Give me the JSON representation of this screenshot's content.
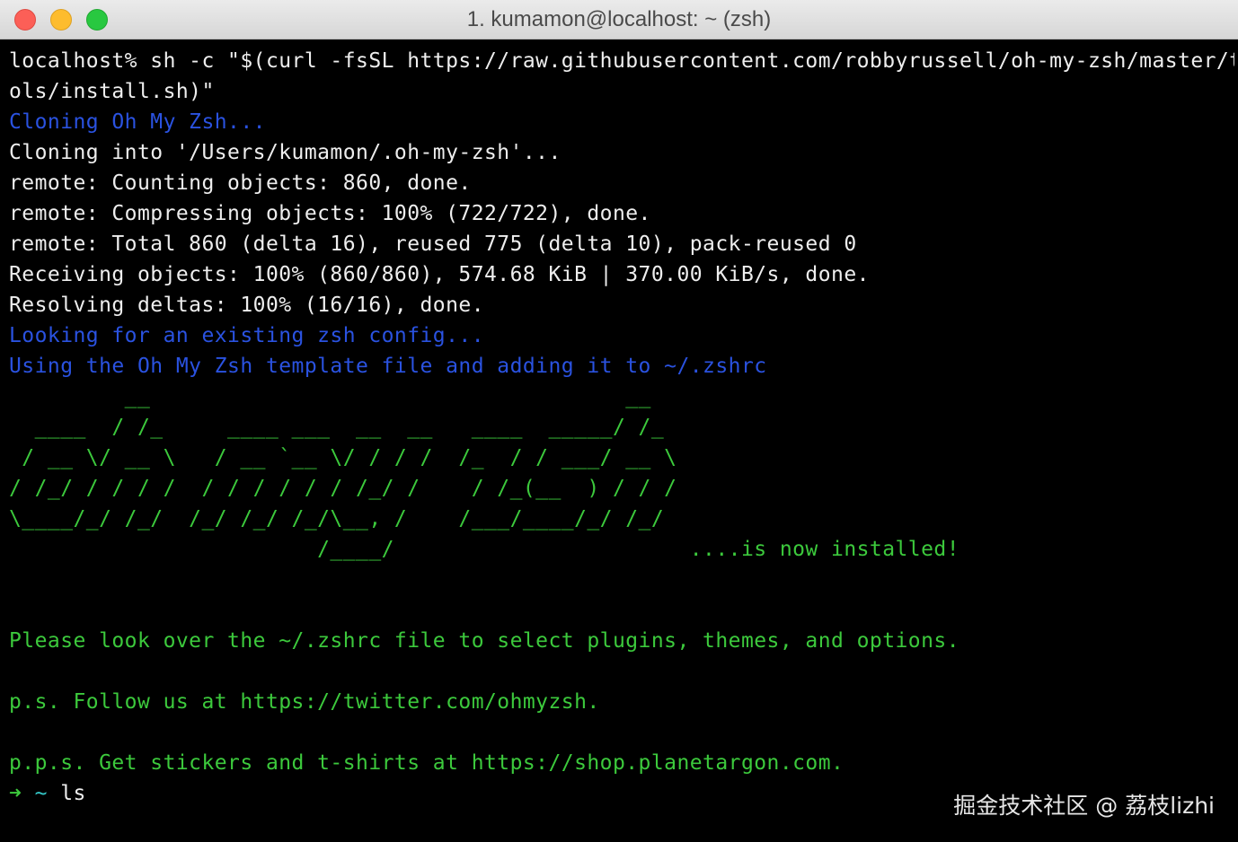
{
  "window": {
    "title": "1. kumamon@localhost: ~ (zsh)"
  },
  "terminal": {
    "lines": [
      {
        "text": "localhost% sh -c \"$(curl -fsSL https://raw.githubusercontent.com/robbyrussell/oh-my-zsh/master/to",
        "color": "default"
      },
      {
        "text": "ols/install.sh)\"",
        "color": "default"
      },
      {
        "text": "Cloning Oh My Zsh...",
        "color": "blue"
      },
      {
        "text": "Cloning into '/Users/kumamon/.oh-my-zsh'...",
        "color": "default"
      },
      {
        "text": "remote: Counting objects: 860, done.",
        "color": "default"
      },
      {
        "text": "remote: Compressing objects: 100% (722/722), done.",
        "color": "default"
      },
      {
        "text": "remote: Total 860 (delta 16), reused 775 (delta 10), pack-reused 0",
        "color": "default"
      },
      {
        "text": "Receiving objects: 100% (860/860), 574.68 KiB | 370.00 KiB/s, done.",
        "color": "default"
      },
      {
        "text": "Resolving deltas: 100% (16/16), done.",
        "color": "default"
      },
      {
        "text": "Looking for an existing zsh config...",
        "color": "blue"
      },
      {
        "text": "Using the Oh My Zsh template file and adding it to ~/.zshrc",
        "color": "blue"
      },
      {
        "text": "         __                                     __",
        "color": "green"
      },
      {
        "text": "  ____  / /_     ____ ___  __  __   ____  _____/ /_",
        "color": "green"
      },
      {
        "text": " / __ \\/ __ \\   / __ `__ \\/ / / /  /_  / / ___/ __ \\",
        "color": "green"
      },
      {
        "text": "/ /_/ / / / /  / / / / / / /_/ /    / /_(__  ) / / /",
        "color": "green"
      },
      {
        "text": "\\____/_/ /_/  /_/ /_/ /_/\\__, /    /___/____/_/ /_/",
        "color": "green"
      },
      {
        "text": "                        /____/                       ....is now installed!",
        "color": "green"
      },
      {
        "text": "",
        "color": "default"
      },
      {
        "text": "",
        "color": "default"
      },
      {
        "text": "Please look over the ~/.zshrc file to select plugins, themes, and options.",
        "color": "green"
      },
      {
        "text": "",
        "color": "default"
      },
      {
        "text": "p.s. Follow us at https://twitter.com/ohmyzsh.",
        "color": "green"
      },
      {
        "text": "",
        "color": "default"
      },
      {
        "text": "p.p.s. Get stickers and t-shirts at https://shop.planetargon.com.",
        "color": "green"
      }
    ],
    "prompt": {
      "arrow": "➜",
      "cwd": "~",
      "command": "ls"
    }
  },
  "watermark": "掘金技术社区 @ 荔枝lizhi",
  "colors": {
    "background": "#000000",
    "default_text": "#eeeeee",
    "blue_text": "#2a52e0",
    "green_text": "#3cc93c",
    "close_button": "#fc5f57",
    "minimize_button": "#fdbc2e",
    "maximize_button": "#28c840"
  }
}
